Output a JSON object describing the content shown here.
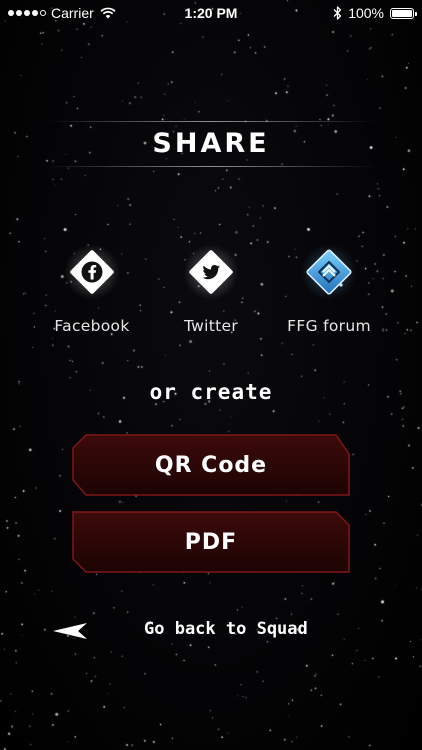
{
  "status_bar": {
    "carrier": "Carrier",
    "time": "1:20 PM",
    "battery": "100%",
    "battery_level": 1.0
  },
  "header": {
    "title": "SHARE"
  },
  "share_targets": [
    {
      "label": "Facebook",
      "icon": "facebook-icon"
    },
    {
      "label": "Twitter",
      "icon": "twitter-icon"
    },
    {
      "label": "FFG forum",
      "icon": "ffg-forum-icon"
    }
  ],
  "create": {
    "heading": "or create",
    "qr_label": "QR Code",
    "pdf_label": "PDF"
  },
  "back": {
    "label": "Go back to Squad",
    "icon": "back-arrow-icon"
  },
  "colors": {
    "button_fill": "#2a0606",
    "button_border": "#8a1a1a",
    "text": "#ffffff"
  }
}
